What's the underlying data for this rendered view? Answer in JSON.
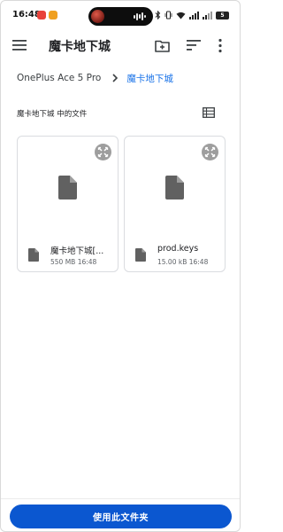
{
  "status_bar": {
    "time": "16:48",
    "battery_level": "5",
    "signal_label": "5G"
  },
  "toolbar": {
    "title": "魔卡地下城",
    "icons": [
      "menu-icon",
      "new-folder-icon",
      "sort-icon",
      "more-icon"
    ]
  },
  "breadcrumb": {
    "root": "OnePlus Ace 5 Pro",
    "current": "魔卡地下城"
  },
  "section": {
    "title": "魔卡地下城 中的文件"
  },
  "files": [
    {
      "name": "魔卡地下城[...",
      "size": "550 MB",
      "time": "16:48",
      "meta": "550 MB 16:48"
    },
    {
      "name": "prod.keys",
      "size": "15.00 kB",
      "time": "16:48",
      "meta": "15.00 kB 16:48"
    }
  ],
  "actions": {
    "use_folder_label": "使用此文件夹"
  },
  "colors": {
    "accent": "#1a73e8",
    "button": "#0b57d0",
    "icon": "#5f6368"
  }
}
